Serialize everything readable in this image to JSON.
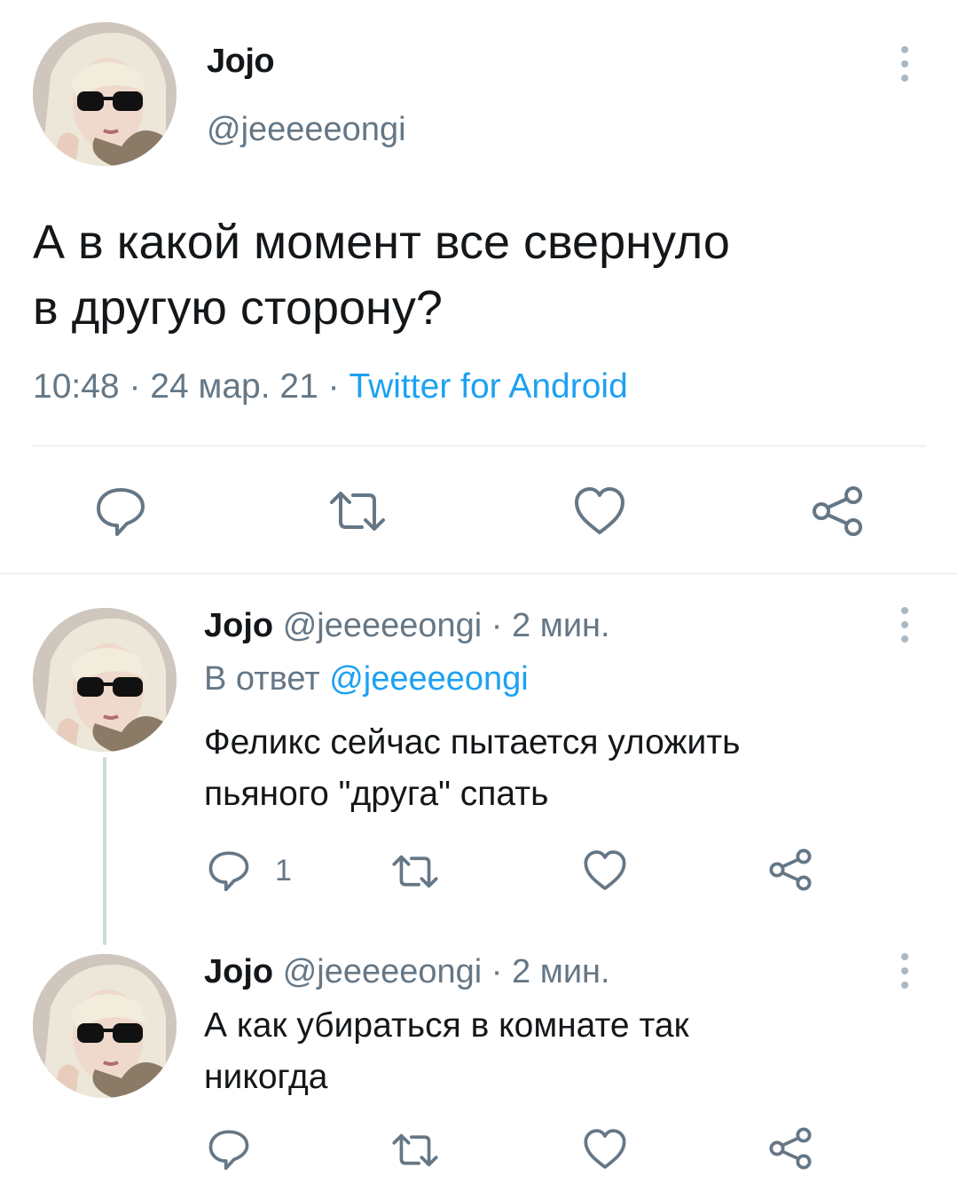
{
  "main_tweet": {
    "author_name": "Jojo",
    "author_handle": "@jeeeeeongi",
    "text_line1": "А в какой момент все свернуло",
    "text_line2": "в другую сторону?",
    "time": "10:48",
    "sep1": "·",
    "date": "24 мар. 21",
    "sep2": "·",
    "source": "Twitter for Android"
  },
  "replies": [
    {
      "author_name": "Jojo",
      "author_handle": "@jeeeeeongi",
      "meta_sep": "·",
      "time_ago": "2 мин.",
      "reply_prefix": "В ответ",
      "reply_to": "@jeeeeeongi",
      "text_line1": "Феликс сейчас пытается уложить",
      "text_line2": "пьяного \"друга\" спать",
      "reply_count": "1"
    },
    {
      "author_name": "Jojo",
      "author_handle": "@jeeeeeongi",
      "meta_sep": "·",
      "time_ago": "2 мин.",
      "text_line1": "А как убираться в комнате так",
      "text_line2": "никогда"
    }
  ],
  "colors": {
    "accent": "#1da1f2",
    "muted": "#657786",
    "icon": "#657786",
    "divider": "#e1e8ed"
  },
  "icons": [
    "more-vertical-icon",
    "reply-icon",
    "retweet-icon",
    "like-icon",
    "share-icon"
  ]
}
